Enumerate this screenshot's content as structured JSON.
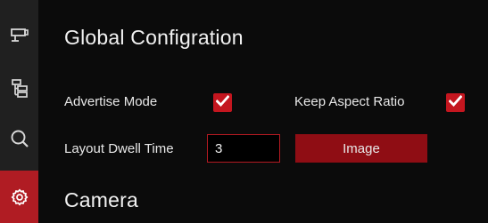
{
  "sidebar": {
    "items": [
      {
        "icon": "camera-icon",
        "active": false
      },
      {
        "icon": "hierarchy-icon",
        "active": false
      },
      {
        "icon": "search-icon",
        "active": false
      },
      {
        "icon": "gear-icon",
        "active": true
      }
    ]
  },
  "global": {
    "title": "Global Configration",
    "advertise_mode": {
      "label": "Advertise Mode",
      "checked": true
    },
    "keep_aspect_ratio": {
      "label": "Keep Aspect Ratio",
      "checked": true
    },
    "layout_dwell_time": {
      "label": "Layout Dwell Time",
      "value": "3"
    },
    "image_button_label": "Image"
  },
  "camera": {
    "title": "Camera"
  },
  "colors": {
    "accent": "#c4161f",
    "button": "#8f0d14",
    "sidebar": "#202020",
    "background": "#0b0b0b"
  }
}
